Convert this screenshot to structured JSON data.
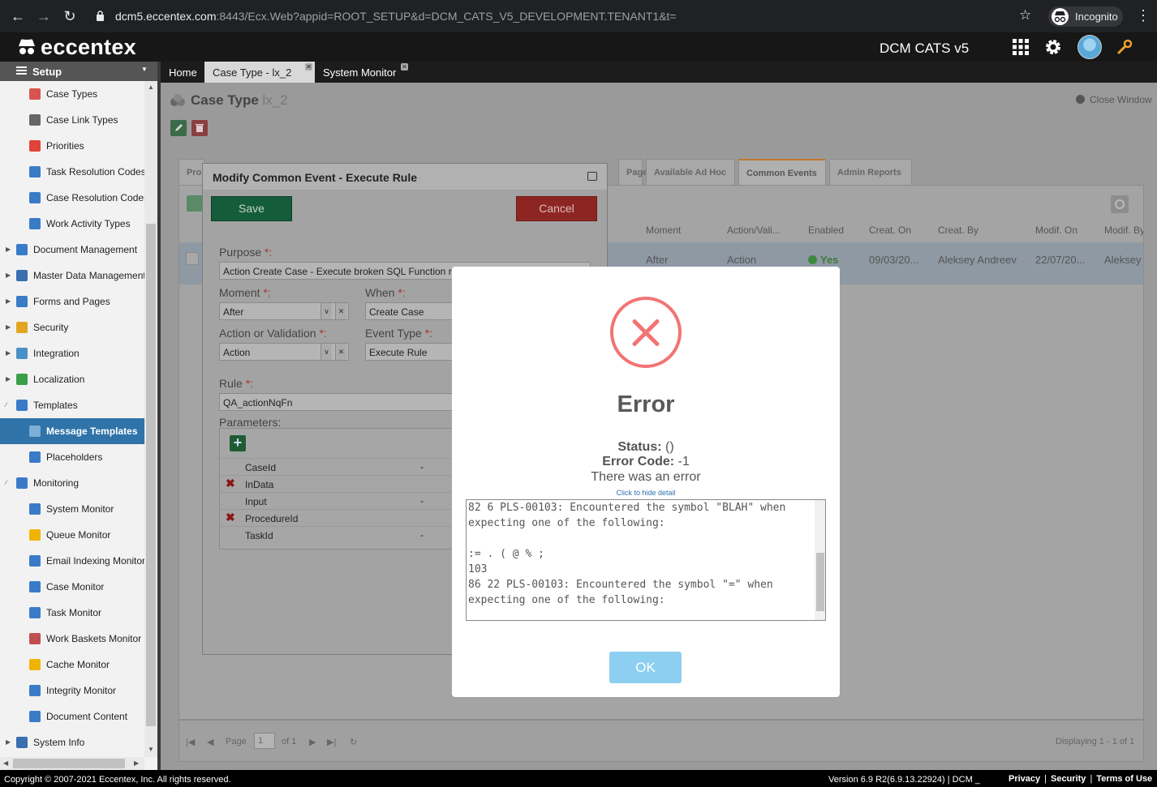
{
  "browser": {
    "url_host": "dcm5.eccentex.com",
    "url_rest": ":8443/Ecx.Web?appid=ROOT_SETUP&d=DCM_CATS_V5_DEVELOPMENT.TENANT1&t=",
    "incognito_label": "Incognito"
  },
  "app": {
    "logo": "eccentex",
    "name": "DCM CATS v5"
  },
  "sidebar": {
    "title": "Setup",
    "items": [
      {
        "label": "Case Types",
        "icon": "case-types-icon",
        "color": "#d9534f",
        "indent": 2
      },
      {
        "label": "Case Link Types",
        "icon": "link-icon",
        "color": "#666666",
        "indent": 2
      },
      {
        "label": "Priorities",
        "icon": "asterisk-icon",
        "color": "#e0443a",
        "indent": 2
      },
      {
        "label": "Task Resolution Codes",
        "icon": "tag-icon",
        "color": "#3a7bc8",
        "indent": 2
      },
      {
        "label": "Case Resolution Codes",
        "icon": "tag-icon",
        "color": "#3a7bc8",
        "indent": 2
      },
      {
        "label": "Work Activity Types",
        "icon": "activity-icon",
        "color": "#3a7bc8",
        "indent": 2
      },
      {
        "label": "Document Management",
        "icon": "document-icon",
        "color": "#3a7bc8",
        "indent": 1
      },
      {
        "label": "Master Data Management",
        "icon": "table-icon",
        "color": "#3a6fb0",
        "indent": 1
      },
      {
        "label": "Forms and Pages",
        "icon": "form-icon",
        "color": "#3a7bc8",
        "indent": 1
      },
      {
        "label": "Security",
        "icon": "lock-icon",
        "color": "#e2a620",
        "indent": 1
      },
      {
        "label": "Integration",
        "icon": "integration-icon",
        "color": "#4a90c8",
        "indent": 1
      },
      {
        "label": "Localization",
        "icon": "globe-icon",
        "color": "#3aa04a",
        "indent": 1
      },
      {
        "label": "Templates",
        "icon": "template-icon",
        "color": "#3a7bc8",
        "indent": 1
      },
      {
        "label": "Message Templates",
        "icon": "message-template-icon",
        "color": "#7ab0d8",
        "indent": 2,
        "active": true
      },
      {
        "label": "Placeholders",
        "icon": "placeholder-icon",
        "color": "#3a7bc8",
        "indent": 2
      },
      {
        "label": "Monitoring",
        "icon": "monitor-icon",
        "color": "#3a7bc8",
        "indent": 1
      },
      {
        "label": "System Monitor",
        "icon": "system-monitor-icon",
        "color": "#3a7bc8",
        "indent": 2
      },
      {
        "label": "Queue Monitor",
        "icon": "star-icon",
        "color": "#f0b400",
        "indent": 2
      },
      {
        "label": "Email Indexing Monitor",
        "icon": "email-icon",
        "color": "#3a7bc8",
        "indent": 2
      },
      {
        "label": "Case Monitor",
        "icon": "case-monitor-icon",
        "color": "#3a7bc8",
        "indent": 2
      },
      {
        "label": "Task Monitor",
        "icon": "task-monitor-icon",
        "color": "#3a7bc8",
        "indent": 2
      },
      {
        "label": "Work Baskets Monitor",
        "icon": "basket-icon",
        "color": "#c05050",
        "indent": 2
      },
      {
        "label": "Cache Monitor",
        "icon": "lightning-icon",
        "color": "#f0b400",
        "indent": 2
      },
      {
        "label": "Integrity Monitor",
        "icon": "integrity-icon",
        "color": "#3a7bc8",
        "indent": 2
      },
      {
        "label": "Document Content",
        "icon": "document-content-icon",
        "color": "#3a7bc8",
        "indent": 2
      },
      {
        "label": "System Info",
        "icon": "terminal-icon",
        "color": "#3a6fb0",
        "indent": 1
      }
    ]
  },
  "tabs": [
    {
      "label": "Home"
    },
    {
      "label": "Case Type - lx_2",
      "active": true
    },
    {
      "label": "System Monitor"
    }
  ],
  "case_type": {
    "title": "Case Type",
    "subtitle": "lx_2",
    "close_window": "Close Window"
  },
  "inner_tabs": [
    {
      "label": "Pro"
    },
    {
      "label": ""
    },
    {
      "label": ""
    },
    {
      "label": ""
    },
    {
      "label": "Pages"
    },
    {
      "label": "Available Ad Hoc"
    },
    {
      "label": "Common Events",
      "active": true
    },
    {
      "label": "Admin Reports"
    }
  ],
  "events_table": {
    "columns": [
      "Moment",
      "Action/Vali...",
      "Enabled",
      "Creat. On",
      "Creat. By",
      "Modif. On",
      "Modif. By"
    ],
    "row": {
      "moment": "After",
      "action": "Action",
      "enabled": "Yes",
      "created_on": "09/03/20...",
      "created_by": "Aleksey Andreev",
      "modified_on": "22/07/20...",
      "modified_by": "Aleksey"
    }
  },
  "pager": {
    "page_label": "Page",
    "page_value": "1",
    "of_label": "of 1",
    "displaying": "Displaying 1 - 1 of 1"
  },
  "modify_dialog": {
    "title": "Modify Common Event - Execute Rule",
    "save": "Save",
    "cancel": "Cancel",
    "purpose_label": "Purpose",
    "purpose_value": "Action Create Case - Execute broken SQL Function rule for sql",
    "moment_label": "Moment",
    "moment_value": "After",
    "when_label": "When",
    "when_value": "Create Case",
    "action_label": "Action or Validation",
    "action_value": "Action",
    "event_type_label": "Event Type",
    "event_type_value": "Execute Rule",
    "rule_label": "Rule",
    "rule_value": "QA_actionNqFn",
    "parameters_label": "Parameters:",
    "required_mark": "*:",
    "parameters": [
      {
        "name": "CaseId",
        "value": "-",
        "missing": false
      },
      {
        "name": "InData",
        "value": "",
        "missing": true
      },
      {
        "name": "Input",
        "value": "-",
        "missing": false
      },
      {
        "name": "ProcedureId",
        "value": "",
        "missing": true
      },
      {
        "name": "TaskId",
        "value": "-",
        "missing": false
      }
    ]
  },
  "error_modal": {
    "title": "Error",
    "status_label": "Status:",
    "status_value": "()",
    "code_label": "Error Code:",
    "code_value": "-1",
    "message": "There was an error",
    "hide_detail": "Click to hide detail",
    "detail": "82 6 PLS-00103: Encountered the symbol \"BLAH\" when expecting one of the following:\n\n:= . ( @ % ;\n103\n86 22 PLS-00103: Encountered the symbol \"=\" when expecting one of the following:",
    "ok": "OK"
  },
  "footer": {
    "copyright": "Copyright © 2007-2021 Eccentex, Inc. All rights reserved.",
    "version": "Version   6.9 R2(6.9.13.22924) | DCM _",
    "links": [
      "Privacy",
      "Security",
      "Terms of Use"
    ]
  }
}
